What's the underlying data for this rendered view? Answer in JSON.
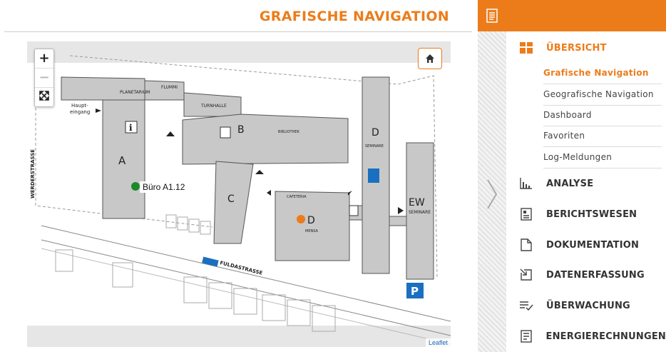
{
  "page": {
    "title": "GRAFISCHE NAVIGATION"
  },
  "map": {
    "zoom_in": "+",
    "zoom_out": "−",
    "fullscreen_icon": "fullscreen-icon",
    "home_icon": "home-icon",
    "attribution": "Leaflet",
    "pin_label": "Büro A1.12",
    "labels": {
      "planetarium": "PLANETARIUM",
      "flummi": "FLUMMI",
      "turnhalle": "TURNHALLE",
      "haupt": "Haupt-",
      "eingang": "eingang",
      "werderstrasse": "WERDERSTRASSE",
      "fuldastrasse": "FULDASTRASSE",
      "bibliothek": "BIBLIOTHEK",
      "building_a": "A",
      "building_b": "B",
      "building_c": "C",
      "building_d_top": "D",
      "building_d": "D",
      "building_ew": "EW",
      "seminare": "SEMINARE",
      "cafeteria": "CAFETERIA",
      "mensa": "MENSA",
      "seminare_ew": "SEMINARE",
      "parking": "P"
    }
  },
  "sidebar": {
    "header_icon": "report-list-icon",
    "sections": [
      {
        "label": "ÜBERSICHT",
        "icon": "dashboard-grid-icon",
        "active": true
      },
      {
        "label": "ANALYSE",
        "icon": "bar-chart-icon"
      },
      {
        "label": "BERICHTSWESEN",
        "icon": "report-icon"
      },
      {
        "label": "DOKUMENTATION",
        "icon": "document-icon"
      },
      {
        "label": "DATENERFASSUNG",
        "icon": "data-entry-icon"
      },
      {
        "label": "ÜBERWACHUNG",
        "icon": "checklist-icon"
      },
      {
        "label": "ENERGIERECHNUNGEN",
        "icon": "invoice-icon"
      }
    ],
    "sub_items": [
      {
        "label": "Grafische Navigation",
        "active": true
      },
      {
        "label": "Geografische Navigation"
      },
      {
        "label": "Dashboard"
      },
      {
        "label": "Favoriten"
      },
      {
        "label": "Log-Meldungen"
      }
    ]
  },
  "colors": {
    "accent": "#ec7c1a",
    "building": "#c8c8c8",
    "pin_green": "#1a8a2a",
    "pin_orange": "#ec7c1a",
    "parking_blue": "#1a6fc0"
  }
}
